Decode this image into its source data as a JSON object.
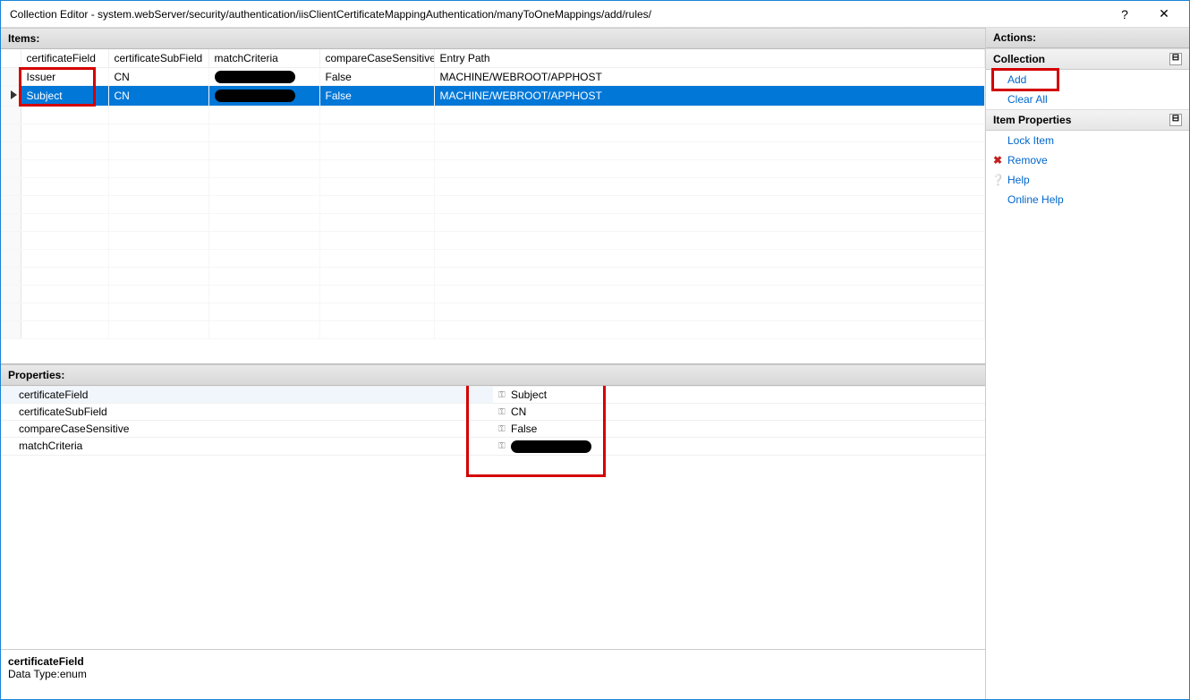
{
  "window": {
    "title": "Collection Editor - system.webServer/security/authentication/iisClientCertificateMappingAuthentication/manyToOneMappings/add/rules/",
    "help_glyph": "?",
    "close_glyph": "✕"
  },
  "items": {
    "heading": "Items:",
    "columns": [
      "certificateField",
      "certificateSubField",
      "matchCriteria",
      "compareCaseSensitive",
      "Entry Path"
    ],
    "rows": [
      {
        "certificateField": "Issuer",
        "certificateSubField": "CN",
        "matchCriteria": "[redacted]",
        "compareCaseSensitive": "False",
        "entryPath": "MACHINE/WEBROOT/APPHOST",
        "selected": false
      },
      {
        "certificateField": "Subject",
        "certificateSubField": "CN",
        "matchCriteria": "[redacted]",
        "compareCaseSensitive": "False",
        "entryPath": "MACHINE/WEBROOT/APPHOST",
        "selected": true
      }
    ]
  },
  "properties": {
    "heading": "Properties:",
    "rows": [
      {
        "name": "certificateField",
        "value": "Subject"
      },
      {
        "name": "certificateSubField",
        "value": "CN"
      },
      {
        "name": "compareCaseSensitive",
        "value": "False"
      },
      {
        "name": "matchCriteria",
        "value": "[redacted]"
      }
    ],
    "description": {
      "name": "certificateField",
      "type": "Data Type:enum"
    }
  },
  "actions": {
    "heading": "Actions:",
    "collection": {
      "title": "Collection",
      "add": "Add",
      "clear_all": "Clear All"
    },
    "item_props": {
      "title": "Item Properties",
      "lock": "Lock Item",
      "remove": "Remove",
      "help": "Help",
      "online_help": "Online Help"
    },
    "collapse_glyph": "⊟"
  }
}
